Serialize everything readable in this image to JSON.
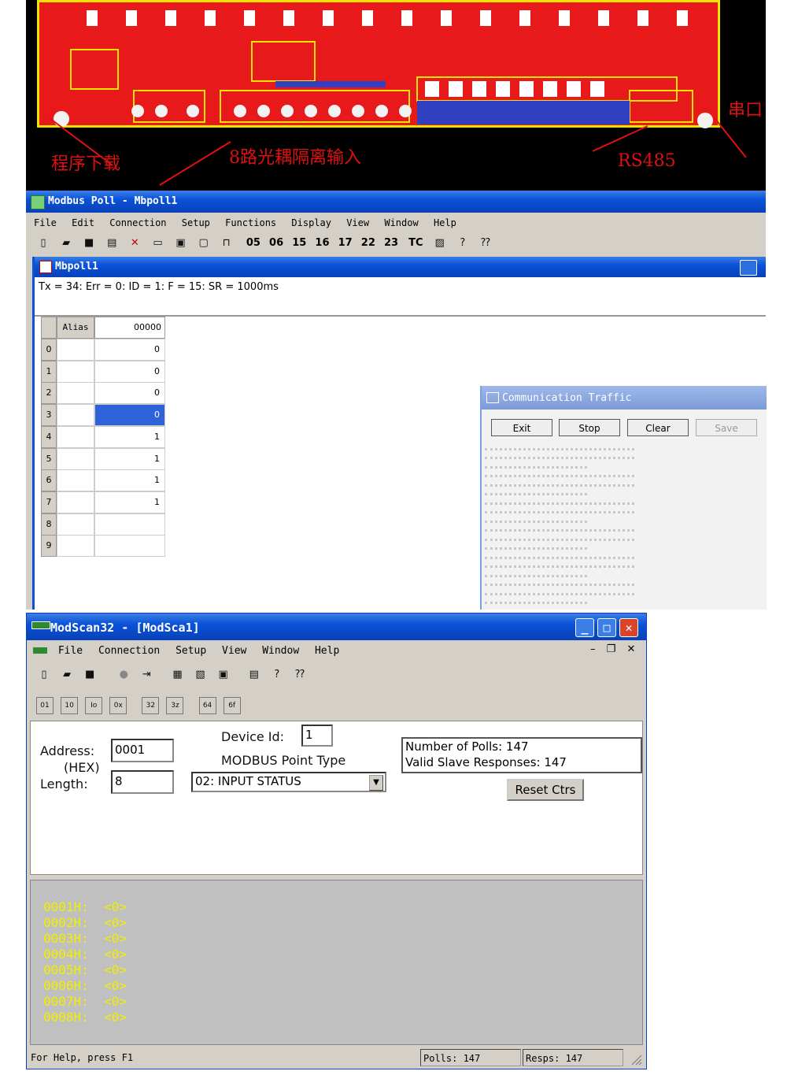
{
  "pcb": {
    "label_download": "程序下载",
    "label_inputs": "8路光耦隔离输入",
    "label_rs485": "RS485",
    "label_serial": "串口"
  },
  "modbus_poll": {
    "title": "Modbus Poll - Mbpoll1",
    "menu": [
      "File",
      "Edit",
      "Connection",
      "Setup",
      "Functions",
      "Display",
      "View",
      "Window",
      "Help"
    ],
    "toolbar_codes": [
      "05",
      "06",
      "15",
      "16",
      "17",
      "22",
      "23",
      "TC"
    ],
    "child_title": "Mbpoll1",
    "status_line": "Tx = 34: Err = 0: ID = 1: F = 15: SR = 1000ms",
    "grid": {
      "header_alias": "Alias",
      "header_col": "00000",
      "rows": [
        {
          "index": "0",
          "value": "0"
        },
        {
          "index": "1",
          "value": "0"
        },
        {
          "index": "2",
          "value": "0"
        },
        {
          "index": "3",
          "value": "0"
        },
        {
          "index": "4",
          "value": "1"
        },
        {
          "index": "5",
          "value": "1"
        },
        {
          "index": "6",
          "value": "1"
        },
        {
          "index": "7",
          "value": "1"
        },
        {
          "index": "8",
          "value": ""
        },
        {
          "index": "9",
          "value": ""
        }
      ],
      "selected_row": 3
    }
  },
  "comm_traffic": {
    "title": "Communication Traffic",
    "buttons": [
      "Exit",
      "Stop",
      "Clear",
      "Save"
    ]
  },
  "modscan": {
    "title": "ModScan32 - [ModSca1]",
    "menu": [
      "File",
      "Connection",
      "Setup",
      "View",
      "Window",
      "Help"
    ],
    "address_label": "Address:",
    "address_value": "0001",
    "hex_label": "(HEX)",
    "length_label": "Length:",
    "length_value": "8",
    "device_id_label": "Device Id:",
    "device_id_value": "1",
    "point_type_label": "MODBUS Point Type",
    "point_type_value": "02: INPUT STATUS",
    "polls_text": "Number of Polls: 147",
    "responses_text": "Valid Slave Responses: 147",
    "reset_button": "Reset Ctrs",
    "data_lines": [
      "0001H:  <0>",
      "0002H:  <0>",
      "0003H:  <0>",
      "0004H:  <0>",
      "0005H:  <0>",
      "0006H:  <0>",
      "0007H:  <0>",
      "0008H:  <0>"
    ],
    "status_help": "For Help, press F1",
    "status_polls": "Polls: 147",
    "status_resps": "Resps: 147"
  }
}
